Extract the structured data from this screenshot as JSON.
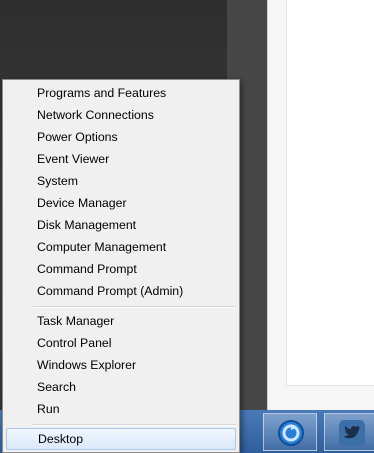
{
  "menu": {
    "group1": [
      "Programs and Features",
      "Network Connections",
      "Power Options",
      "Event Viewer",
      "System",
      "Device Manager",
      "Disk Management",
      "Computer Management",
      "Command Prompt",
      "Command Prompt (Admin)"
    ],
    "group2": [
      "Task Manager",
      "Control Panel",
      "Windows Explorer",
      "Search",
      "Run"
    ],
    "group3": [
      "Desktop"
    ]
  },
  "taskbar": {
    "buttons": [
      {
        "icon": "blue-circle-arrow-icon"
      },
      {
        "icon": "twitter-bird-icon"
      }
    ],
    "color": "#3a6aa8"
  },
  "colors": {
    "menu_bg": "#f0f0f0",
    "highlight": "#dbe9fa"
  }
}
